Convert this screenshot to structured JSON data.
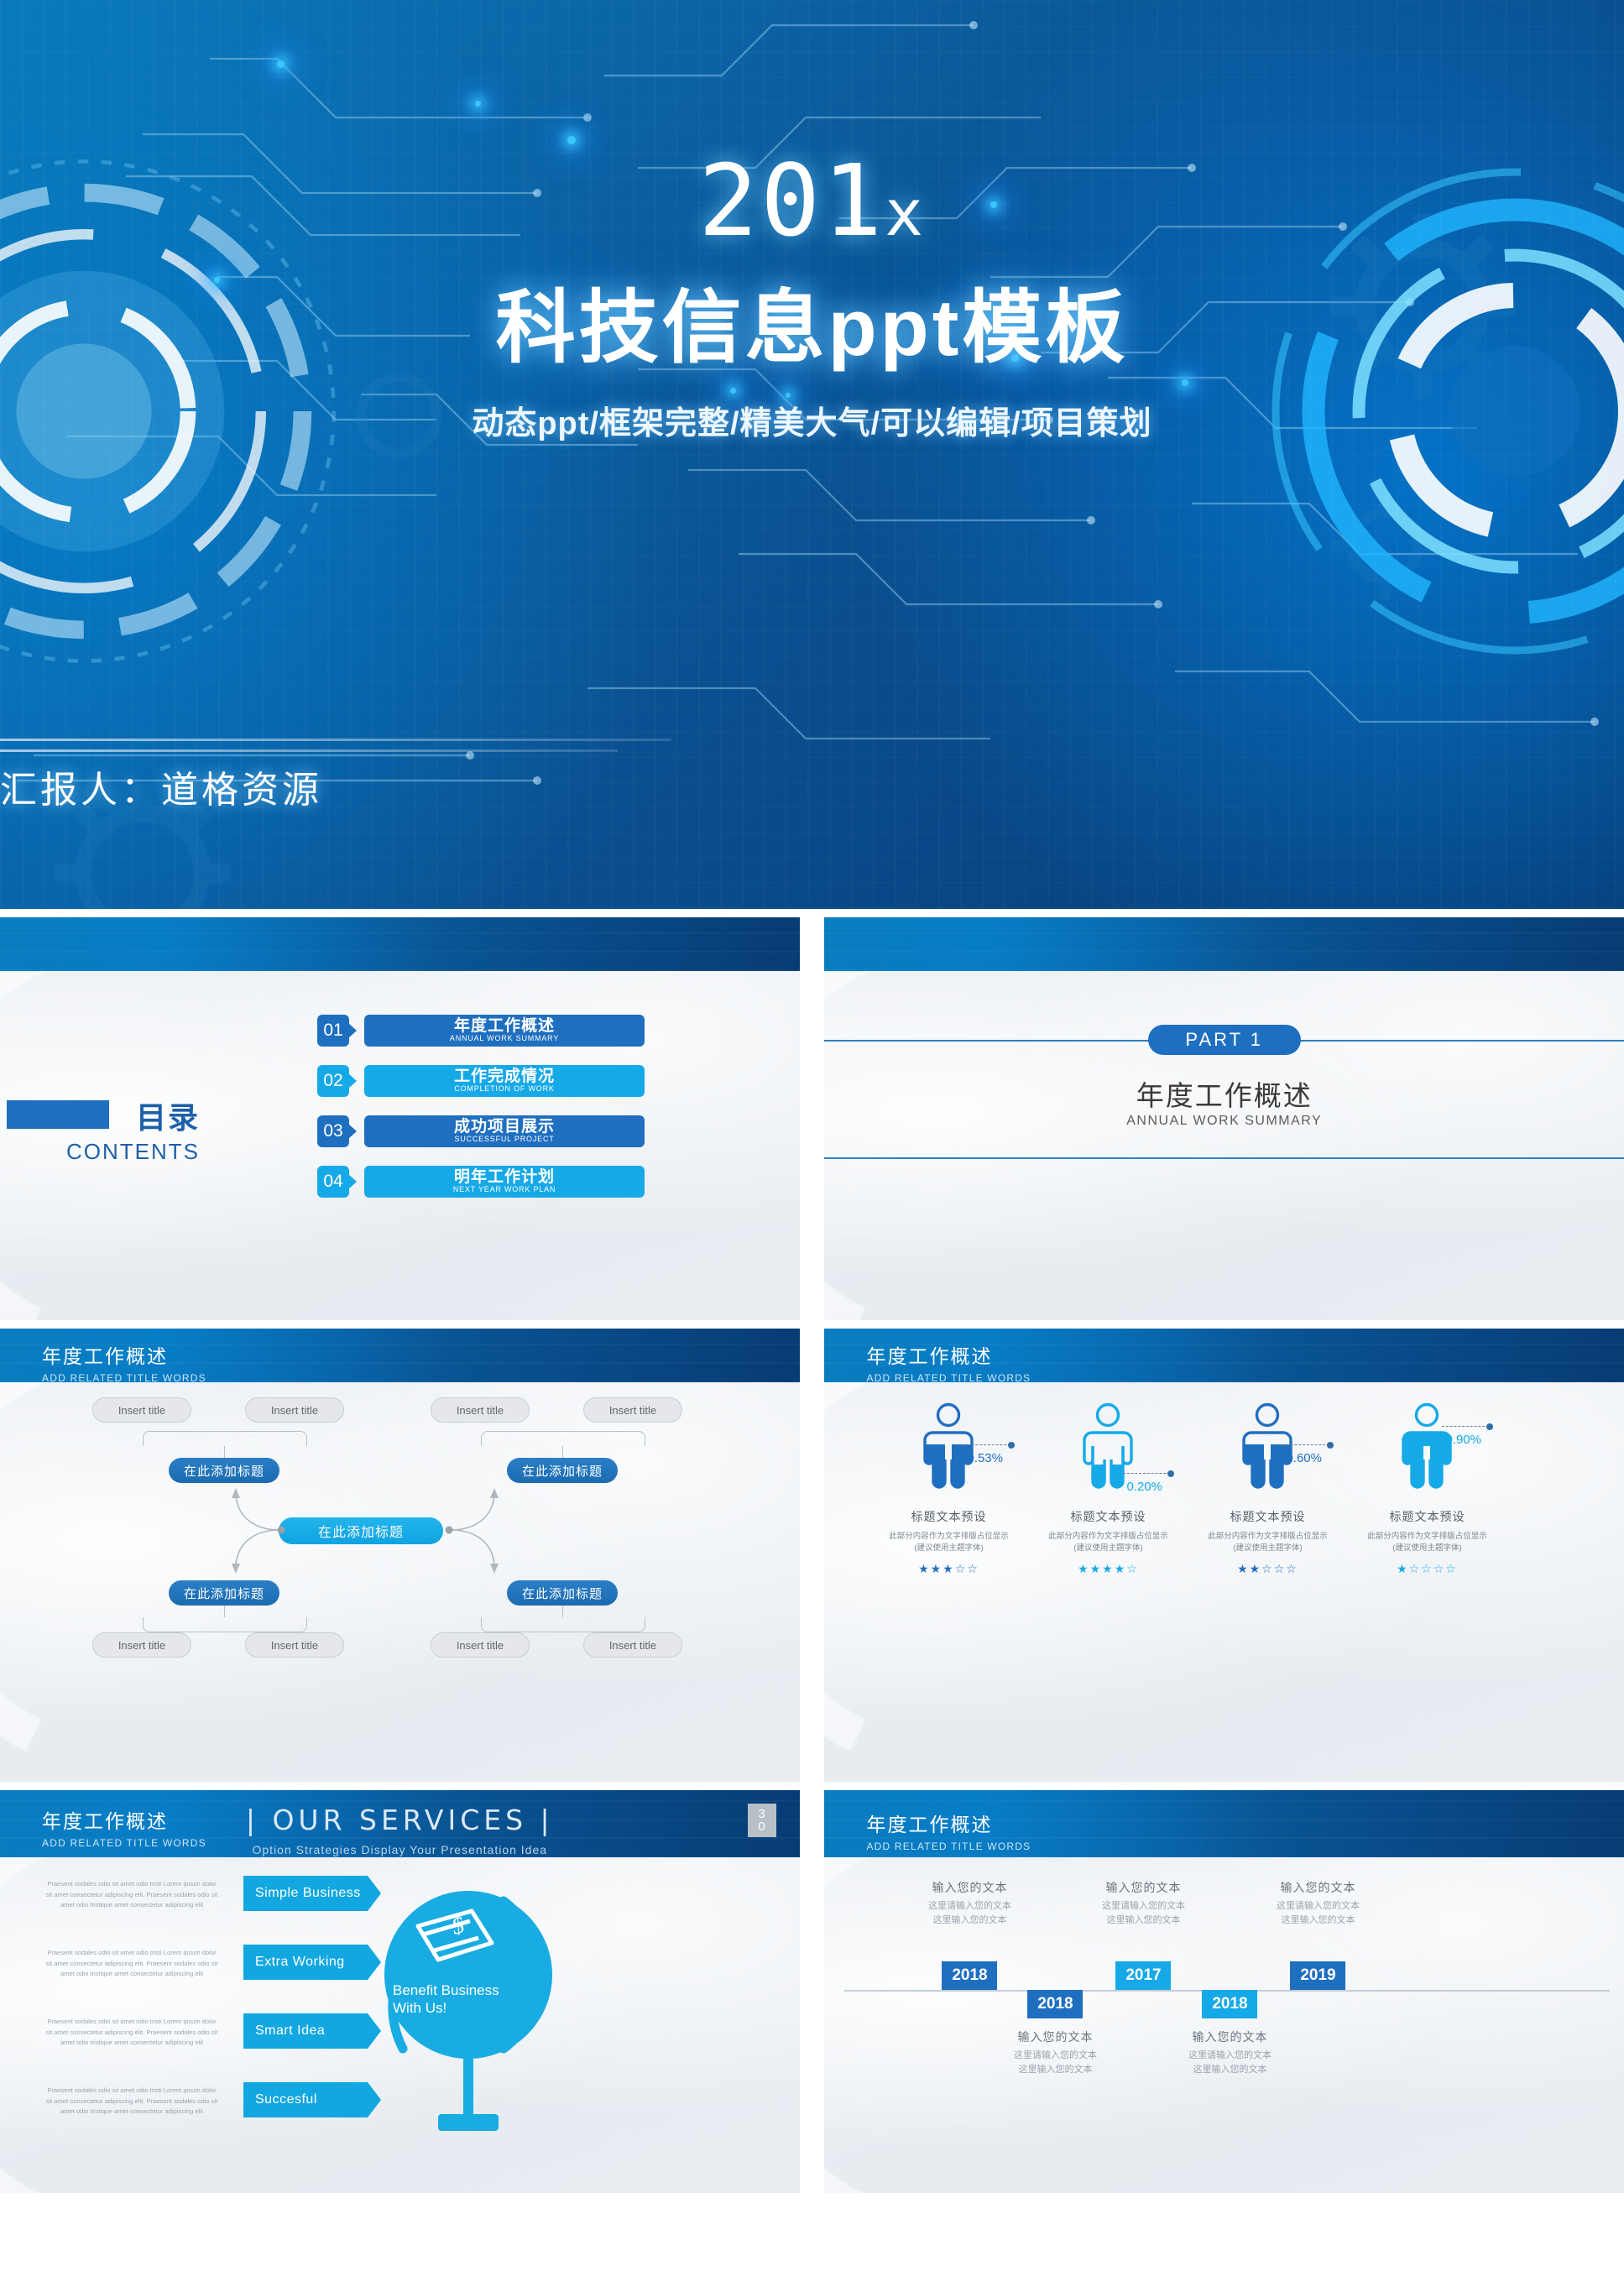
{
  "cover": {
    "year": "201",
    "year_suffix": "x",
    "title": "科技信息ppt模板",
    "subtitle": "动态ppt/框架完整/精美大气/可以编辑/项目策划",
    "presenter": "汇报人：道格资源"
  },
  "contents": {
    "title_cn": "目录",
    "title_en": "CONTENTS",
    "items": [
      {
        "num": "01",
        "cn": "年度工作概述",
        "en": "ANNUAL WORK SUMMARY",
        "color": "#1f6fc0"
      },
      {
        "num": "02",
        "cn": "工作完成情况",
        "en": "COMPLETION OF WORK",
        "color": "#16a9e8"
      },
      {
        "num": "03",
        "cn": "成功项目展示",
        "en": "SUCCESSFUL PROJECT",
        "color": "#1f6fc0"
      },
      {
        "num": "04",
        "cn": "明年工作计划",
        "en": "NEXT YEAR WORK PLAN",
        "color": "#16a9e8"
      }
    ]
  },
  "part": {
    "badge": "PART  1",
    "cn": "年度工作概述",
    "en": "ANNUAL WORK SUMMARY"
  },
  "slide_header": {
    "cn": "年度工作概述",
    "en": "ADD RELATED TITLE WORDS"
  },
  "flowchart": {
    "gray_label": "Insert title",
    "blue_label": "在此添加标题",
    "center_label": "在此添加标题",
    "top_gray": [
      "Insert title",
      "Insert title",
      "Insert title",
      "Insert title"
    ],
    "bottom_gray": [
      "Insert title",
      "Insert title",
      "Insert title",
      "Insert title"
    ],
    "branch_nodes": [
      "在此添加标题",
      "在此添加标题",
      "在此添加标题",
      "在此添加标题"
    ]
  },
  "people": {
    "items": [
      {
        "pct": "0.53%",
        "title": "标题文本预设",
        "desc_line1": "此部分内容作为文字排版占位显示",
        "desc_line2": "(建议使用主题字体)",
        "stars": 3,
        "fill": 0.53,
        "color": "#1f6fc0"
      },
      {
        "pct": "0.20%",
        "title": "标题文本预设",
        "desc_line1": "此部分内容作为文字排版占位显示",
        "desc_line2": "(建议使用主题字体)",
        "stars": 4,
        "fill": 0.2,
        "color": "#16a9e8"
      },
      {
        "pct": "0.60%",
        "title": "标题文本预设",
        "desc_line1": "此部分内容作为文字排版占位显示",
        "desc_line2": "(建议使用主题字体)",
        "stars": 2,
        "fill": 0.6,
        "color": "#1f6fc0"
      },
      {
        "pct": "0.90%",
        "title": "标题文本预设",
        "desc_line1": "此部分内容作为文字排版占位显示",
        "desc_line2": "(建议使用主题字体)",
        "stars": 1,
        "fill": 0.9,
        "color": "#16a9e8"
      }
    ],
    "star_filled": "★",
    "star_empty": "☆"
  },
  "services": {
    "title": "| OUR SERVICES |",
    "subtitle": "Option Strategies Display Your Presentation Idea",
    "badge_top": "3",
    "badge_bottom": "0",
    "paragraph": "Praesent sodales odio sit amet odio tristi Lorem ipsum dolor sit amet consectetur adipiscing elit. Praesent sodales odio sit amet odio tristique amet consectetur adipiscing elit",
    "tabs": [
      "Simple Business",
      "Extra Working",
      "Smart Idea",
      "Succesful"
    ],
    "globe_line1": "Benefit Business",
    "globe_line2": "With Us!",
    "globe_icon": "money-bill-icon"
  },
  "timeline": {
    "entries": [
      {
        "year": "2018",
        "pos": "above",
        "heading": "输入您的文本",
        "line1": "这里请输入您的文本",
        "line2": "这里输入您的文本",
        "color": "#1f6fc0"
      },
      {
        "year": "2018",
        "pos": "below",
        "heading": "输入您的文本",
        "line1": "这里请输入您的文本",
        "line2": "这里输入您的文本",
        "color": "#1f6fc0"
      },
      {
        "year": "2017",
        "pos": "above",
        "heading": "输入您的文本",
        "line1": "这里请输入您的文本",
        "line2": "这里输入您的文本",
        "color": "#16a9e8"
      },
      {
        "year": "2018",
        "pos": "below",
        "heading": "输入您的文本",
        "line1": "这里请输入您的文本",
        "line2": "这里输入您的文本",
        "color": "#16a9e8"
      },
      {
        "year": "2019",
        "pos": "above",
        "heading": "输入您的文本",
        "line1": "这里请输入您的文本",
        "line2": "这里输入您的文本",
        "color": "#1f6fc0"
      }
    ]
  },
  "colors": {
    "deep_blue": "#0a4e8e",
    "mid_blue": "#1f6fc0",
    "cyan": "#16a9e8",
    "panel": "#eceff3"
  }
}
